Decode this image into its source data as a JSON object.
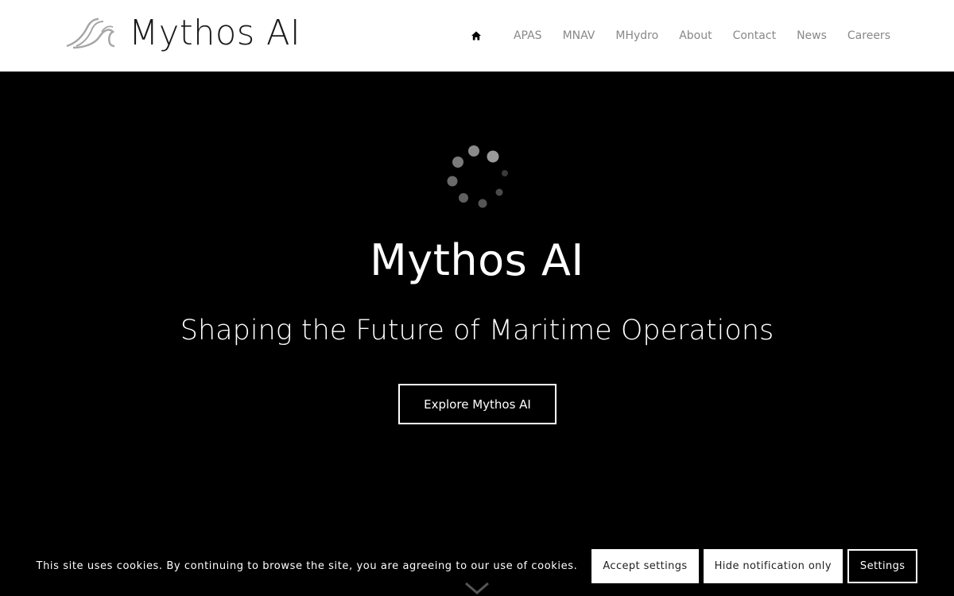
{
  "header": {
    "logo_text": "Mythos AI",
    "logo_icon": "wave-logo-icon",
    "nav": {
      "home_icon": "home-icon",
      "items": [
        {
          "label": "APAS"
        },
        {
          "label": "MNAV"
        },
        {
          "label": "MHydro"
        },
        {
          "label": "About"
        },
        {
          "label": "Contact"
        },
        {
          "label": "News"
        },
        {
          "label": "Careers"
        }
      ]
    }
  },
  "hero": {
    "loading_icon": "loading-spinner-icon",
    "title": "Mythos AI",
    "subtitle": "Shaping the Future of Maritime Operations",
    "cta_label": "Explore Mythos AI",
    "scroll_icon": "chevron-down-icon"
  },
  "cookie_notice": {
    "text": "This site uses cookies. By continuing to browse the site, you are agreeing to our use of cookies.",
    "accept_label": "Accept settings",
    "hide_label": "Hide notification only",
    "settings_label": "Settings"
  },
  "colors": {
    "header_bg": "#ffffff",
    "hero_bg": "#000000",
    "nav_text": "#888888",
    "logo_text": "#1a1a1a"
  }
}
